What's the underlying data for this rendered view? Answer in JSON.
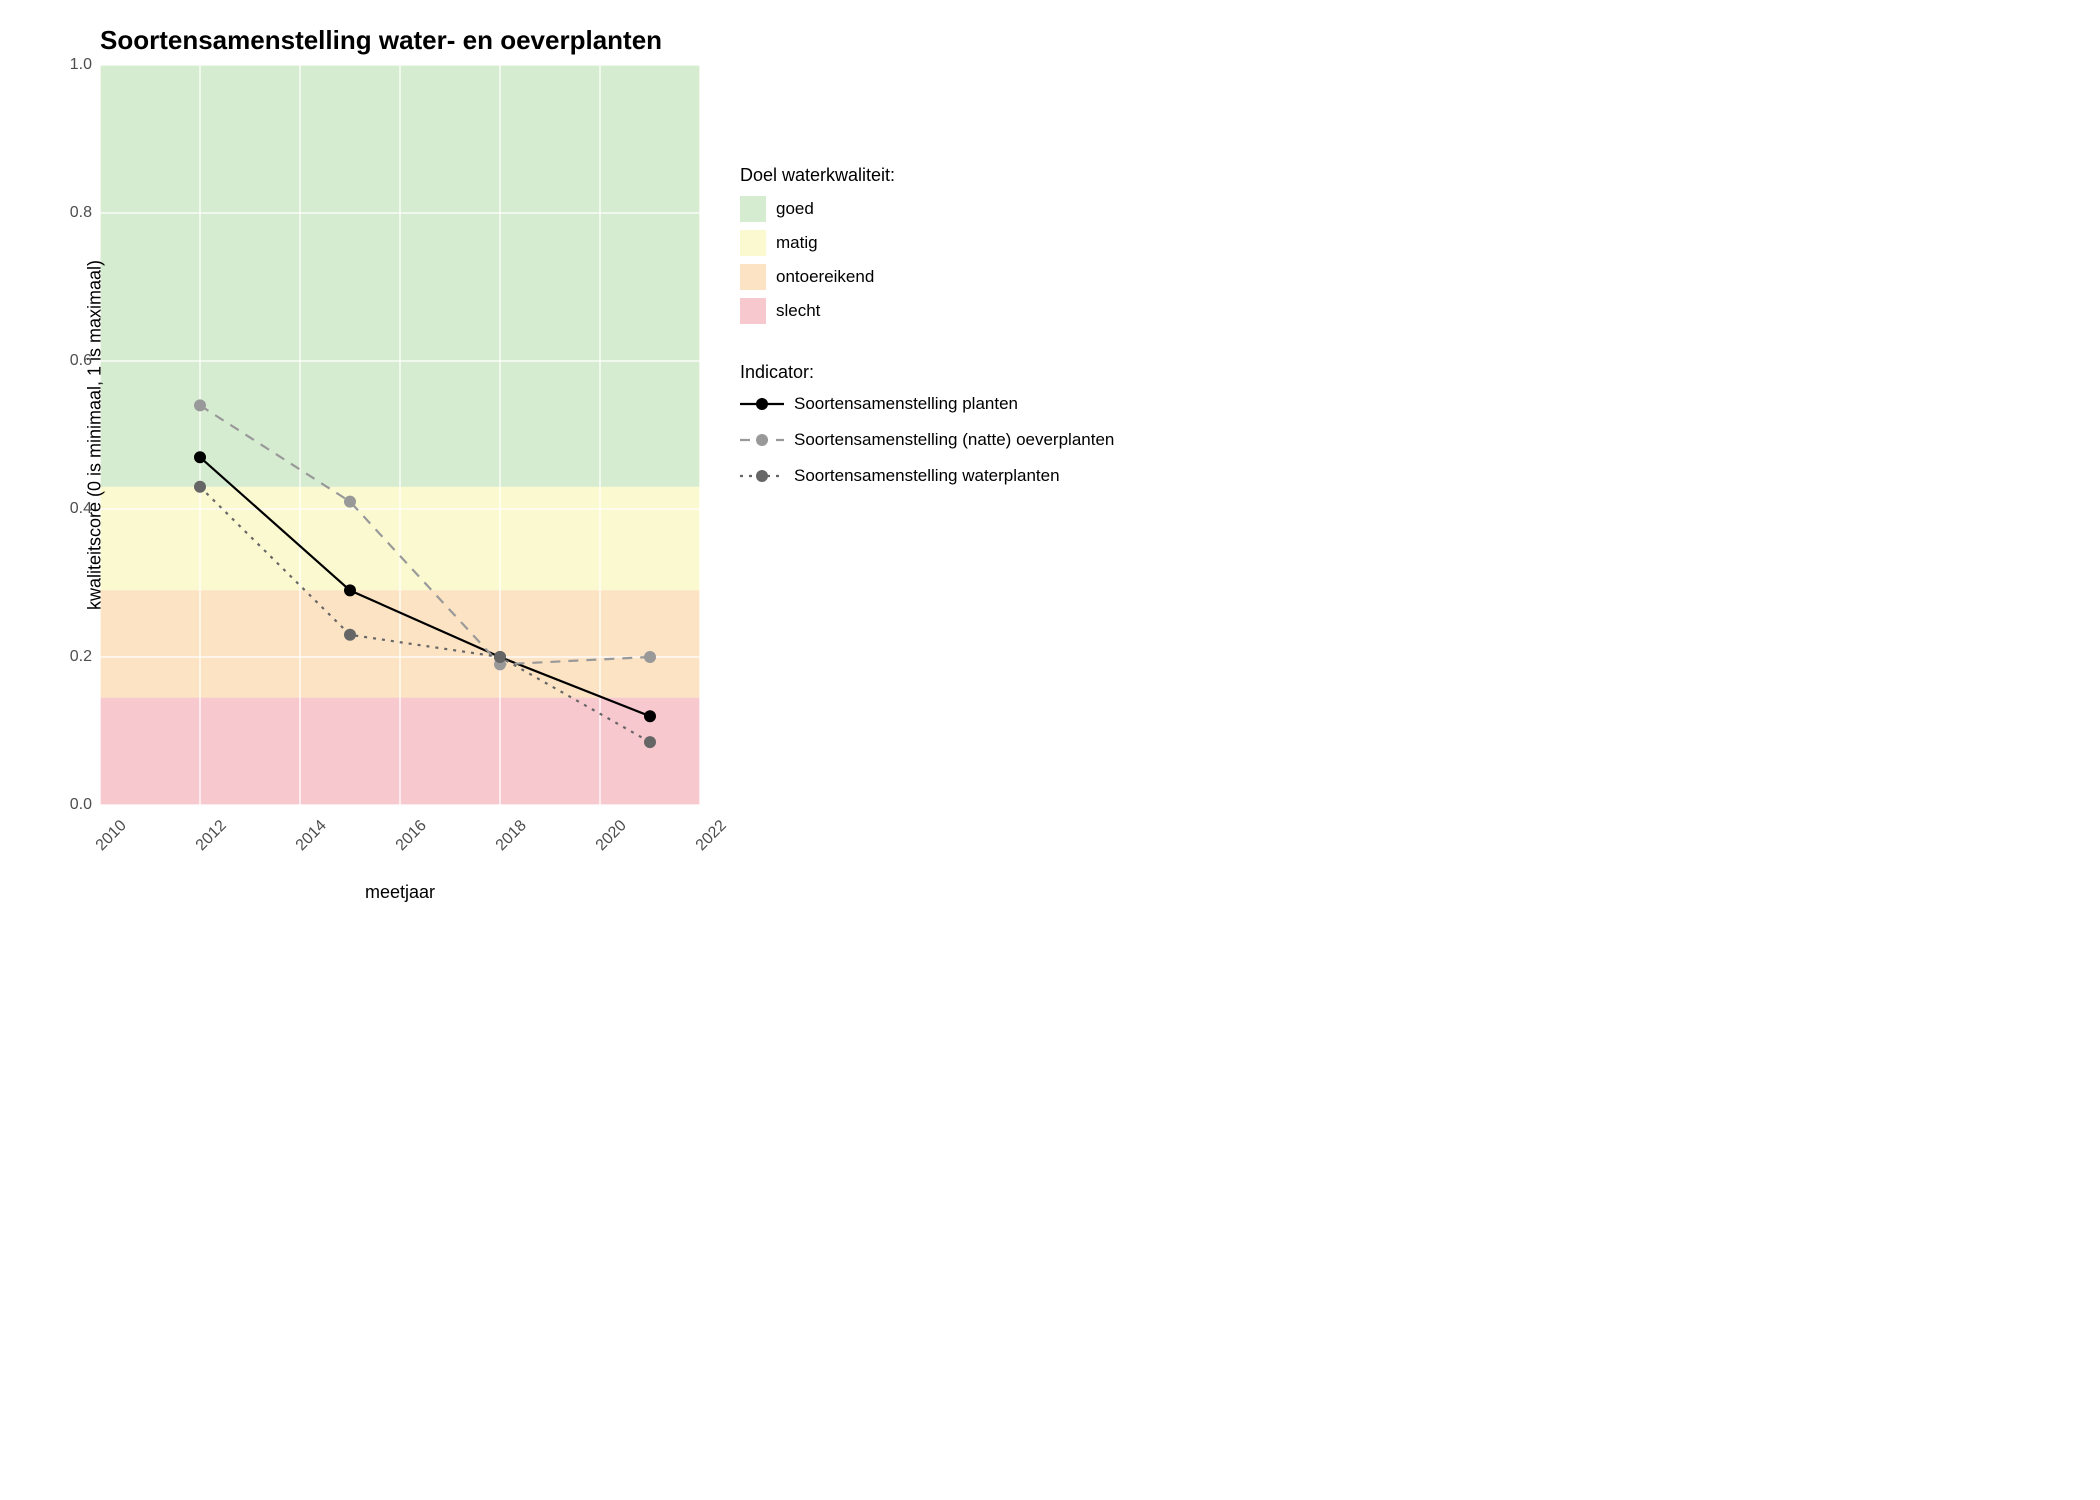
{
  "chart_data": {
    "type": "line",
    "title": "Soortensamenstelling water- en oeverplanten",
    "xlabel": "meetjaar",
    "ylabel": "kwaliteitscore (0 is minimaal, 1 is maximaal)",
    "xlim": [
      2010,
      2022
    ],
    "ylim": [
      0,
      1.0
    ],
    "x_ticks": [
      2010,
      2012,
      2014,
      2016,
      2018,
      2020,
      2022
    ],
    "y_ticks": [
      0.0,
      0.2,
      0.4,
      0.6,
      0.8,
      1.0
    ],
    "x": [
      2012,
      2015,
      2018,
      2021
    ],
    "series": [
      {
        "name": "Soortensamenstelling planten",
        "values": [
          0.47,
          0.29,
          0.2,
          0.12
        ],
        "color": "#000000",
        "dash": "solid"
      },
      {
        "name": "Soortensamenstelling (natte) oeverplanten",
        "values": [
          0.54,
          0.41,
          0.19,
          0.2
        ],
        "color": "#999999",
        "dash": "dashed"
      },
      {
        "name": "Soortensamenstelling waterplanten",
        "values": [
          0.43,
          0.23,
          0.2,
          0.085
        ],
        "color": "#666666",
        "dash": "dotted"
      }
    ],
    "bands": [
      {
        "name": "goed",
        "from": 0.43,
        "to": 1.0,
        "color": "#d6ecd0"
      },
      {
        "name": "matig",
        "from": 0.29,
        "to": 0.43,
        "color": "#fbf9d0"
      },
      {
        "name": "ontoereikend",
        "from": 0.145,
        "to": 0.29,
        "color": "#fce3c4"
      },
      {
        "name": "slecht",
        "from": 0.0,
        "to": 0.145,
        "color": "#f8c8cf"
      }
    ],
    "legend_bands_title": "Doel waterkwaliteit:",
    "legend_series_title": "Indicator:"
  }
}
